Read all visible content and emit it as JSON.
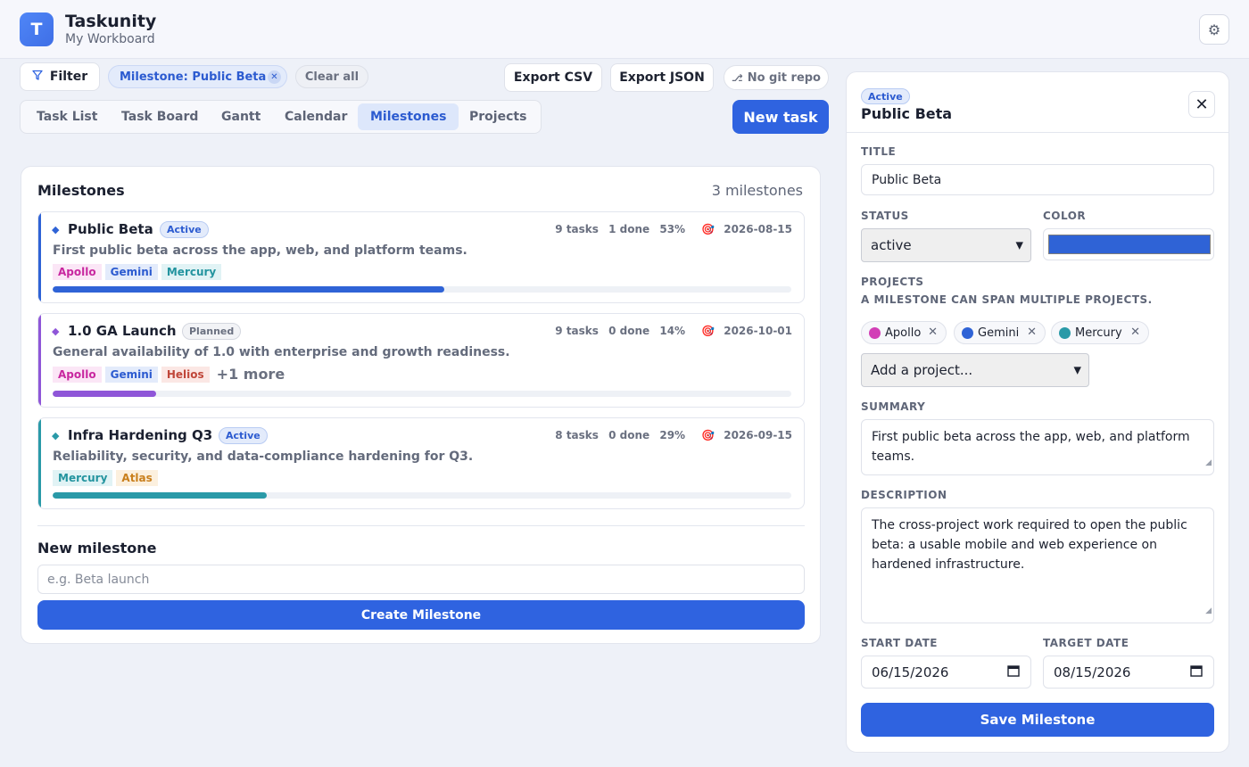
{
  "app": {
    "logo_letter": "T",
    "title": "Taskunity",
    "subtitle": "My Workboard"
  },
  "toolbar": {
    "filter_label": "Filter",
    "active_filter": "Milestone: Public Beta",
    "clear_all": "Clear all",
    "export_csv": "Export CSV",
    "export_json": "Export JSON",
    "git_status": "No git repo"
  },
  "tabs": [
    {
      "label": "Task List"
    },
    {
      "label": "Task Board"
    },
    {
      "label": "Gantt"
    },
    {
      "label": "Calendar"
    },
    {
      "label": "Milestones",
      "active": true
    },
    {
      "label": "Projects"
    }
  ],
  "new_task_label": "New task",
  "milestones_card": {
    "title": "Milestones",
    "count": "3 milestones",
    "items": [
      {
        "name": "Public Beta",
        "status": "Active",
        "tasks": "9 tasks",
        "done": "1 done",
        "percent": "53%",
        "progress": 53,
        "target": "2026-08-15",
        "description": "First public beta across the app, web, and platform teams.",
        "tags": [
          "Apollo",
          "Gemini",
          "Mercury"
        ],
        "more": "",
        "color": "#2f63d6"
      },
      {
        "name": "1.0 GA Launch",
        "status": "Planned",
        "tasks": "9 tasks",
        "done": "0 done",
        "percent": "14%",
        "progress": 14,
        "target": "2026-10-01",
        "description": "General availability of 1.0 with enterprise and growth readiness.",
        "tags": [
          "Apollo",
          "Gemini",
          "Helios"
        ],
        "more": "+1 more",
        "color": "#8f56d8"
      },
      {
        "name": "Infra Hardening Q3",
        "status": "Active",
        "tasks": "8 tasks",
        "done": "0 done",
        "percent": "29%",
        "progress": 29,
        "target": "2026-09-15",
        "description": "Reliability, security, and data-compliance hardening for Q3.",
        "tags": [
          "Mercury",
          "Atlas"
        ],
        "more": "",
        "color": "#2a9aa8"
      }
    ],
    "new_label": "New milestone",
    "new_placeholder": "e.g. Beta launch",
    "create_label": "Create Milestone"
  },
  "panel": {
    "status": "Active",
    "title": "Public Beta",
    "title_label": "TITLE",
    "title_value": "Public Beta",
    "status_label": "STATUS",
    "status_value": "active",
    "color_label": "COLOR",
    "color_value": "#2f63d6",
    "projects_label": "PROJECTS",
    "projects_hint": "A MILESTONE CAN SPAN MULTIPLE PROJECTS.",
    "projects": [
      {
        "name": "Apollo",
        "color": "#d23fb6"
      },
      {
        "name": "Gemini",
        "color": "#2f63d6"
      },
      {
        "name": "Mercury",
        "color": "#2a9aa8"
      }
    ],
    "add_project": "Add a project...",
    "summary_label": "SUMMARY",
    "summary": "First public beta across the app, web, and platform teams.",
    "description_label": "DESCRIPTION",
    "description": "The cross-project work required to open the public beta: a usable mobile and web experience on hardened infrastructure.",
    "start_label": "START DATE",
    "start_date": "06/15/2026",
    "target_label": "TARGET DATE",
    "target_date": "08/15/2026",
    "save_label": "Save Milestone"
  }
}
